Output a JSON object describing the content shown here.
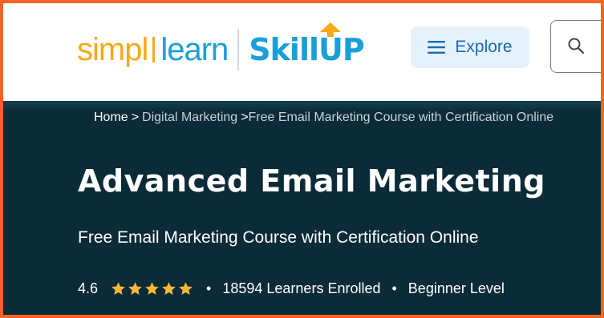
{
  "header": {
    "logo": {
      "simpl": "simpl",
      "learn": "learn",
      "skill": "Skill",
      "up": "UP"
    },
    "explore_label": "Explore",
    "icons": {
      "menu": "hamburger-menu-icon",
      "search": "search-icon"
    }
  },
  "breadcrumb": {
    "home": "Home",
    "separator": ">",
    "category": "Digital Marketing",
    "current": "Free Email Marketing Course with Certification Online"
  },
  "course": {
    "title": "Advanced Email Marketing",
    "subtitle": "Free Email Marketing Course with Certification Online",
    "rating": "4.6",
    "stars": 5,
    "learners": "18594 Learners Enrolled",
    "level": "Beginner Level",
    "bullet": "•"
  },
  "colors": {
    "frame": "#f26522",
    "hero_bg": "#0b2b38",
    "brand_orange": "#f7a81b",
    "brand_blue": "#1a9fd8",
    "star": "#f5b936",
    "explore_bg": "#e6f2fb",
    "explore_text": "#1b69b4"
  }
}
